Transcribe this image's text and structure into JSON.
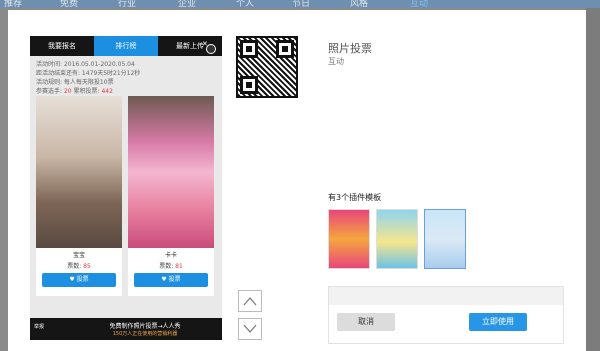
{
  "background_nav": [
    "推荐",
    "免费",
    "行业",
    "企业",
    "个人",
    "节日",
    "风格",
    "互动"
  ],
  "phone": {
    "tabs": [
      "我要报名",
      "排行榜",
      "最新上传"
    ],
    "info": {
      "time": "活动时间: 2016.05.01-2020.05.04",
      "remaining": "距活动结束还有: 1479天5时21分12秒",
      "rule": "活动规则: 每人每天限投10票",
      "participants_label": "参赛选手:",
      "participants": "20",
      "total_votes_label": "累积投票:",
      "total_votes": "442"
    },
    "cards": [
      {
        "name": "宝宝",
        "votes_label": "票数:",
        "votes": "85",
        "button": "投票"
      },
      {
        "name": "卡卡",
        "votes_label": "票数:",
        "votes": "81",
        "button": "投票"
      }
    ],
    "bottom": {
      "report": "举报",
      "promo_line1": "免费制作照片投票→人人秀",
      "promo_line2": "150万人正在使用的营销利器"
    }
  },
  "panel": {
    "title": "照片投票",
    "subtitle": "互动",
    "plugins_label": "有3个插件模板"
  },
  "actions": {
    "cancel": "取消",
    "use": "立即使用"
  },
  "colors": {
    "primary": "#2796e6",
    "highlight": "#e03a3a"
  }
}
